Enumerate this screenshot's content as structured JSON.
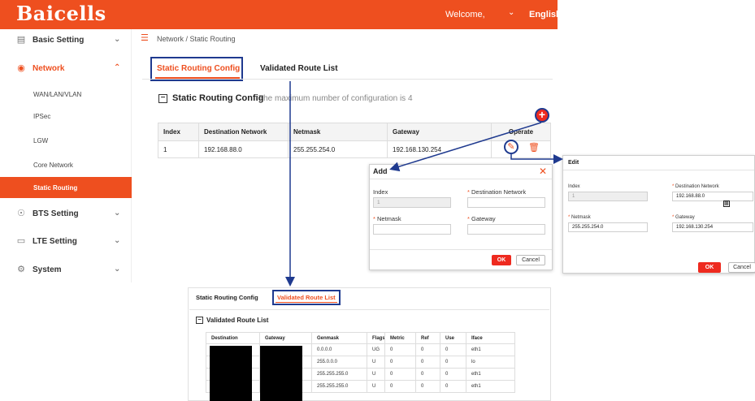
{
  "header": {
    "logo": "Baicells",
    "welcome": "Welcome,",
    "language": "English"
  },
  "sidebar": {
    "items": [
      {
        "label": "Basic Setting",
        "icon": "doc-icon",
        "arrow": "chevron-down"
      },
      {
        "label": "Network",
        "icon": "globe-icon",
        "arrow": "chevron-up"
      },
      {
        "label": "BTS Setting",
        "icon": "antenna-icon",
        "arrow": "chevron-down"
      },
      {
        "label": "LTE Setting",
        "icon": "bars-icon",
        "arrow": "chevron-down"
      },
      {
        "label": "System",
        "icon": "gear-icon",
        "arrow": "chevron-down"
      }
    ],
    "network_sub": [
      "WAN/LAN/VLAN",
      "IPSec",
      "LGW",
      "Core Network",
      "Static Routing"
    ]
  },
  "breadcrumb": "Network / Static Routing",
  "tabs": [
    "Static Routing Config",
    "Validated Route List"
  ],
  "section": {
    "title": "Static Routing Config",
    "note": "The maximum number of configuration is 4"
  },
  "routes_table": {
    "headers": [
      "Index",
      "Destination Network",
      "Netmask",
      "Gateway",
      "Operate"
    ],
    "rows": [
      [
        "1",
        "192.168.88.0",
        "255.255.254.0",
        "192.168.130.254"
      ]
    ]
  },
  "add_dialog": {
    "title": "Add",
    "index_label": "Index",
    "index_value": "1",
    "dest_label": "Destination Network",
    "netmask_label": "Netmask",
    "gateway_label": "Gateway",
    "ok": "OK",
    "cancel": "Cancel"
  },
  "edit_dialog": {
    "title": "Edit",
    "index_label": "Index",
    "index_value": "1",
    "dest_label": "Destination Network",
    "dest_value": "192.168.88.0",
    "netmask_label": "Netmask",
    "netmask_value": "255.255.254.0",
    "gateway_label": "Gateway",
    "gateway_value": "192.168.130.254",
    "ok": "OK",
    "cancel": "Cancel"
  },
  "validated": {
    "tabs": [
      "Static Routing Config",
      "Validated Route List"
    ],
    "title": "Validated Route List",
    "headers": [
      "Destination",
      "Gateway",
      "Genmask",
      "Flags",
      "Metric",
      "Ref",
      "Use",
      "Iface"
    ],
    "rows": [
      [
        "",
        "",
        "0.0.0.0",
        "UG",
        "0",
        "0",
        "0",
        "eth1"
      ],
      [
        "",
        "",
        "255.0.0.0",
        "U",
        "0",
        "0",
        "0",
        "lo"
      ],
      [
        "",
        "",
        "255.255.255.0",
        "U",
        "0",
        "0",
        "0",
        "eth1"
      ],
      [
        "",
        "",
        "255.255.255.0",
        "U",
        "0",
        "0",
        "0",
        "eth1"
      ]
    ]
  },
  "colors": {
    "brand": "#ee4f1f",
    "annotation": "#1f3a8f"
  }
}
